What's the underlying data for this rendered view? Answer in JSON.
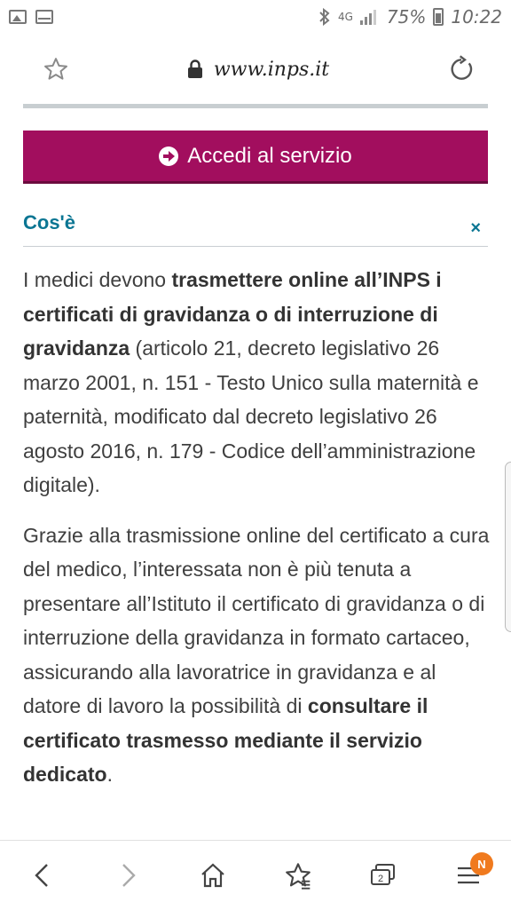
{
  "status_bar": {
    "network": "4G",
    "battery_percent": "75%",
    "time": "10:22",
    "left_icons": [
      "image-notification-icon",
      "mail-notification-icon"
    ]
  },
  "browser": {
    "url": "www.inps.it",
    "icons": {
      "bookmark": "star-icon",
      "lock": "lock-icon",
      "reload": "reload-icon"
    }
  },
  "access_button": {
    "label": "Accedi al servizio"
  },
  "section": {
    "title": "Cos'è",
    "close": "×"
  },
  "content": {
    "p1": {
      "a": "I medici devono ",
      "b": "trasmettere online all’INPS i certificati di gravidanza o di interruzione di gravidanza",
      "c": " (articolo 21, decreto legislativo 26 marzo 2001, n. 151 - Testo Unico sulla maternità e paternità, modificato dal decreto legislativo 26 agosto 2016, n. 179 - Codice dell’amministrazione digitale)."
    },
    "p2": {
      "a": "Grazie alla trasmissione online del certificato a cura del medico, l’interessata non è più tenuta a presentare all’Istituto il certificato di gravidanza o di interruzione della gravidanza in formato cartaceo, assicurando alla lavoratrice in gravidanza e al datore di lavoro la possibilità di ",
      "b": "consultare il certificato trasmesso mediante il servizio dedicato",
      "c": "."
    }
  },
  "bottom_nav": {
    "items": [
      "back-icon",
      "forward-icon",
      "home-icon",
      "bookmarks-icon",
      "tabs-icon",
      "menu-icon"
    ],
    "tabs_count": "2",
    "menu_badge": "N"
  },
  "colors": {
    "accent": "#a20e5e",
    "link": "#0b7693",
    "badge": "#f07a1e"
  }
}
